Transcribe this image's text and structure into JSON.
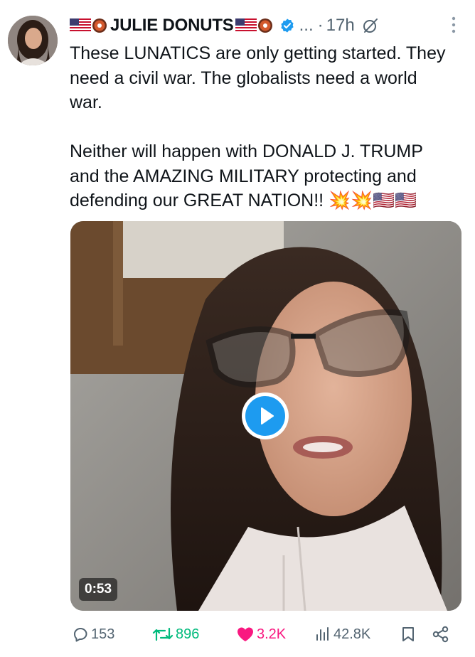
{
  "post": {
    "display_name": "JULIE DONUTS",
    "more_label": "...",
    "dot": "·",
    "time": "17h",
    "body": "These LUNATICS are only getting started. They need a civil war. The globalists need a world war.\n\nNeither will happen with DONALD J. TRUMP and the AMAZING MILITARY protecting and defending our GREAT NATION!!",
    "emoji_tail": "💥💥🇺🇸🇺🇸"
  },
  "media": {
    "duration": "0:53"
  },
  "actions": {
    "replies": "153",
    "reposts": "896",
    "likes": "3.2K",
    "views": "42.8K"
  },
  "colors": {
    "accent": "#1d9bf0",
    "repost": "#00ba7c",
    "like": "#f91880",
    "muted": "#536471"
  },
  "icons": [
    "us-flag-icon",
    "donut-icon",
    "verified-badge-icon",
    "grok-icon",
    "more-vertical-icon",
    "play-icon",
    "reply-icon",
    "repost-icon",
    "like-icon",
    "views-icon",
    "bookmark-icon",
    "share-icon"
  ]
}
